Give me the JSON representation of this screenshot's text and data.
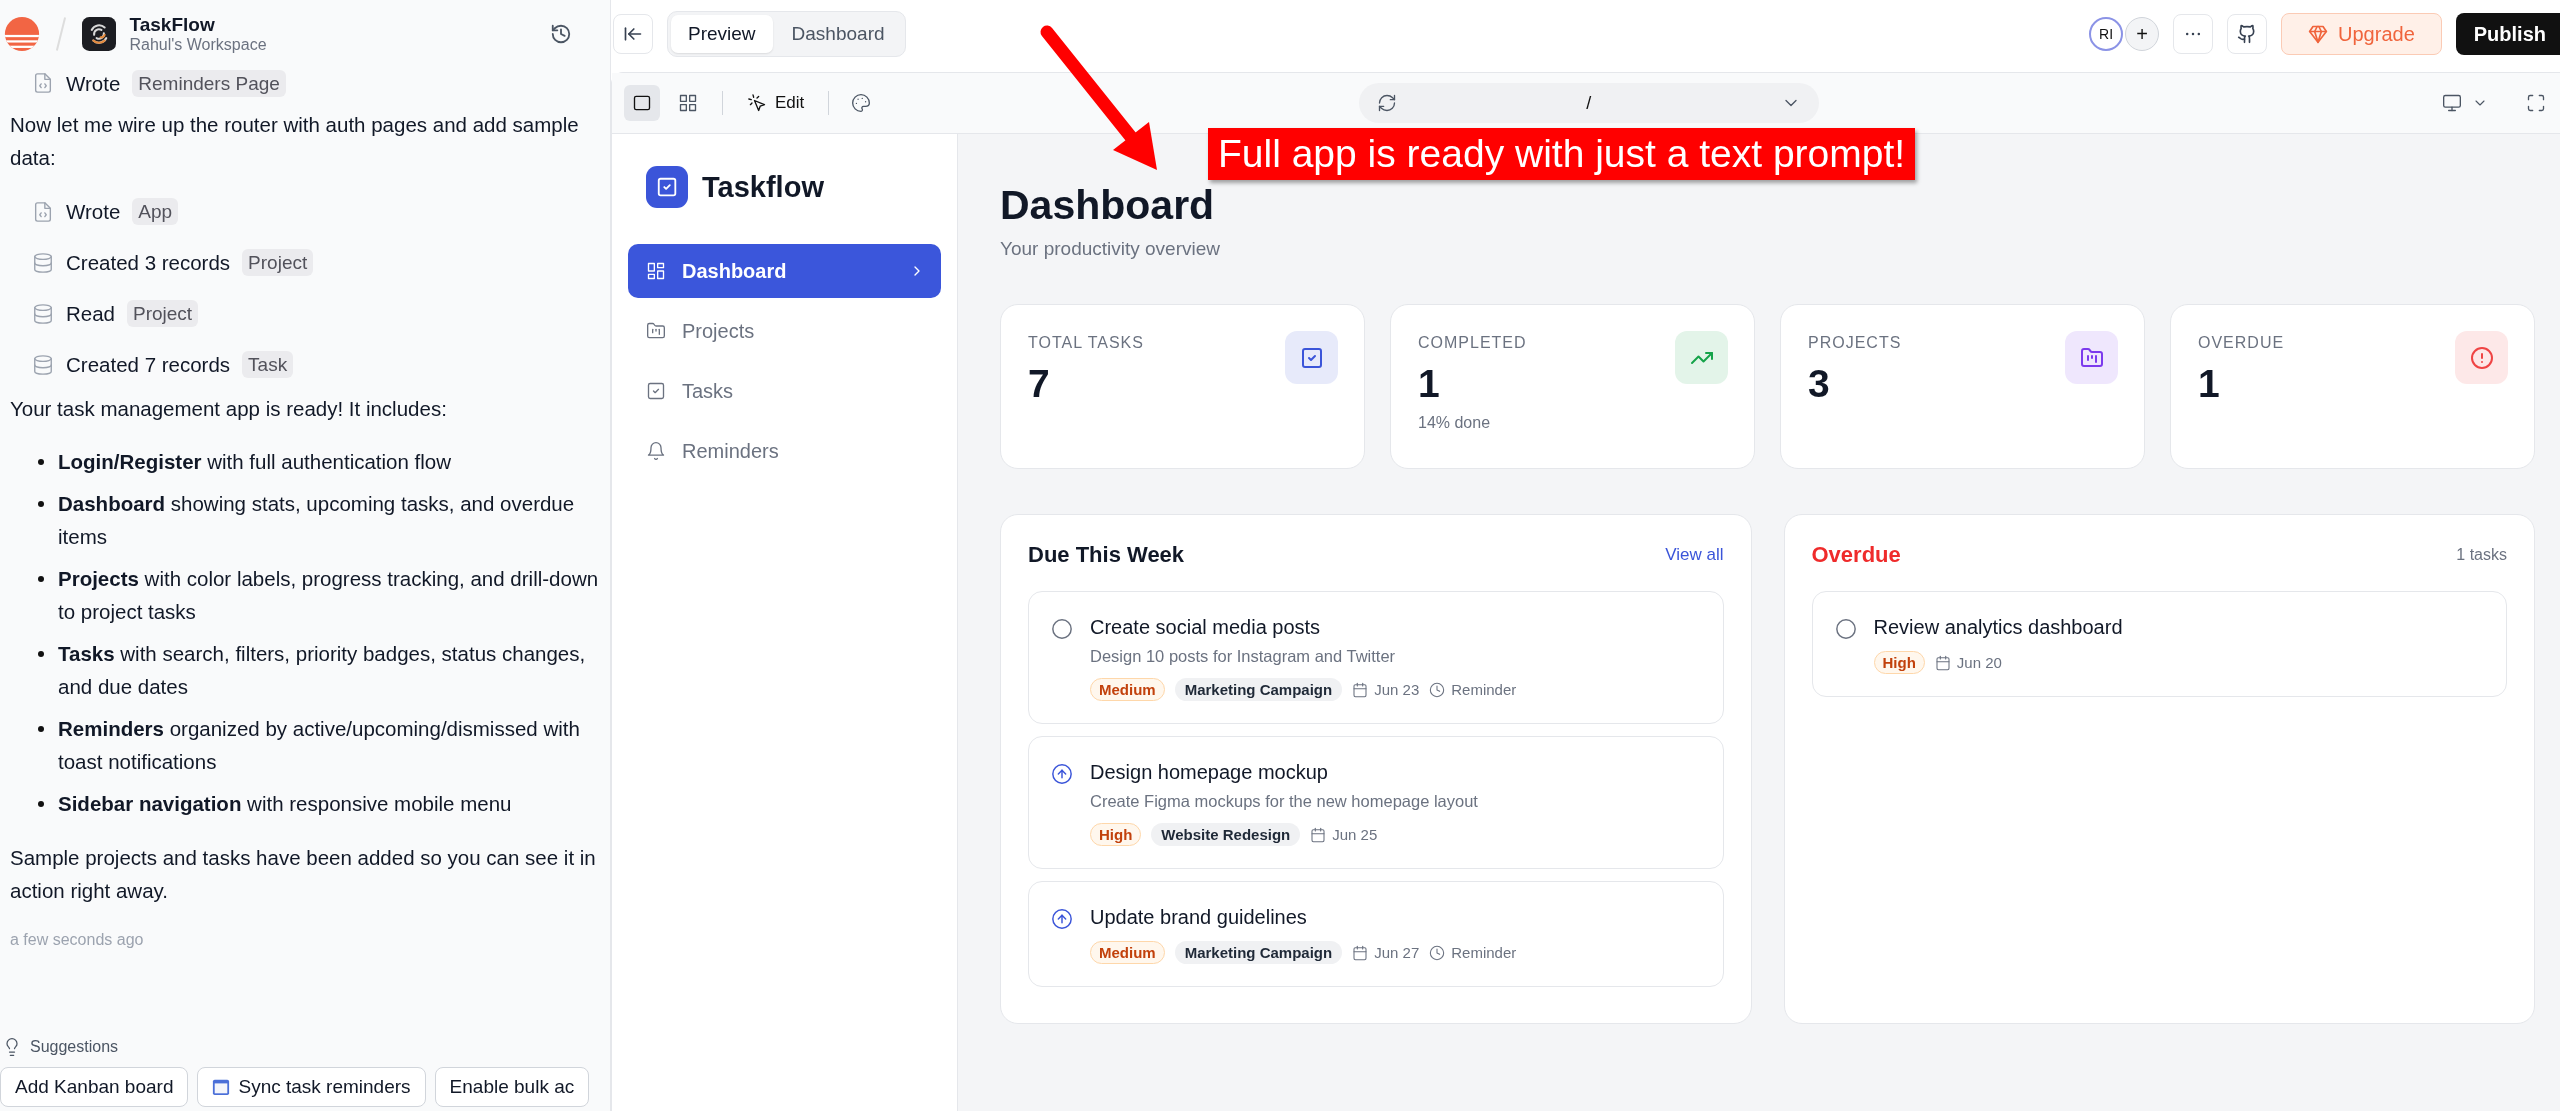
{
  "chat_header": {
    "title": "TaskFlow",
    "subtitle": "Rahul's Workspace"
  },
  "chat": [
    {
      "kind": "file",
      "verb": "Wrote",
      "tag": "Reminders Page"
    },
    {
      "kind": "text",
      "text": "Now let me wire up the router with auth pages and add sample data:"
    },
    {
      "kind": "file",
      "verb": "Wrote",
      "tag": "App"
    },
    {
      "kind": "database",
      "verb": "Created 3 records",
      "tag": "Project"
    },
    {
      "kind": "database",
      "verb": "Read",
      "tag": "Project"
    },
    {
      "kind": "database",
      "verb": "Created 7 records",
      "tag": "Task"
    },
    {
      "kind": "text",
      "text": "Your task management app is ready! It includes:"
    },
    {
      "kind": "bullets",
      "items": [
        "**Login/Register** with full authentication flow",
        "**Dashboard** showing stats, upcoming tasks, and overdue items",
        "**Projects** with color labels, progress tracking, and drill-down to project tasks",
        "**Tasks** with search, filters, priority badges, status changes, and due dates",
        "**Reminders** organized by active/upcoming/dismissed with toast notifications",
        "**Sidebar navigation** with responsive mobile menu"
      ]
    },
    {
      "kind": "text",
      "text": "Sample projects and tasks have been added so you can see it in action right away."
    },
    {
      "kind": "time",
      "text": "a few seconds ago"
    }
  ],
  "suggestions": {
    "label": "Suggestions",
    "items": [
      {
        "text": "Add Kanban board",
        "kind": "plain"
      },
      {
        "text": "Sync task reminders",
        "kind": "calendar"
      },
      {
        "text": "Enable bulk ac",
        "kind": "plain"
      }
    ]
  },
  "topbar": {
    "tabs": [
      {
        "label": "Preview",
        "selected": true
      },
      {
        "label": "Dashboard",
        "selected": false
      }
    ],
    "avatar": "RI",
    "add": "+",
    "upgrade": "Upgrade",
    "publish": "Publish"
  },
  "preview_toolbar": {
    "views": [
      {
        "kind": "single",
        "selected": true
      },
      {
        "kind": "grid",
        "selected": false
      }
    ],
    "edit": "Edit",
    "url": "/"
  },
  "app": {
    "brand": "Taskflow",
    "nav": [
      {
        "label": "Dashboard",
        "selected": true
      },
      {
        "label": "Projects",
        "selected": false
      },
      {
        "label": "Tasks",
        "selected": false
      },
      {
        "label": "Reminders",
        "selected": false
      }
    ],
    "title": "Dashboard",
    "subtitle": "Your productivity overview",
    "stats": [
      {
        "label": "TOTAL TASKS",
        "value": "7",
        "kind": "check",
        "color": "#3b55d9"
      },
      {
        "label": "COMPLETED",
        "value": "1",
        "note": "14% done",
        "kind": "trend",
        "color": "#16a34a"
      },
      {
        "label": "PROJECTS",
        "value": "3",
        "kind": "folder",
        "color": "#7c3aed"
      },
      {
        "label": "OVERDUE",
        "value": "1",
        "kind": "alert",
        "color": "#ef4444"
      }
    ],
    "due": {
      "title": "Due This Week",
      "link": "View all",
      "tasks": [
        {
          "title": "Create social media posts",
          "description": "Design 10 posts for Instagram and Twitter",
          "kind": "todo",
          "priority": "Medium",
          "project": "Marketing Campaign",
          "date": "Jun 23",
          "reminder": "Reminder"
        },
        {
          "title": "Design homepage mockup",
          "description": "Create Figma mockups for the new homepage layout",
          "kind": "in_progress",
          "priority": "High",
          "project": "Website Redesign",
          "date": "Jun 25"
        },
        {
          "title": "Update brand guidelines",
          "kind": "in_progress",
          "priority": "Medium",
          "project": "Marketing Campaign",
          "date": "Jun 27",
          "reminder": "Reminder"
        }
      ]
    },
    "overdue": {
      "title": "Overdue",
      "count": "1 tasks",
      "tasks": [
        {
          "title": "Review analytics dashboard",
          "kind": "todo",
          "priority": "High",
          "date": "Jun 20"
        }
      ]
    }
  },
  "annotation": {
    "text": "Full app is ready with just a text prompt!"
  }
}
